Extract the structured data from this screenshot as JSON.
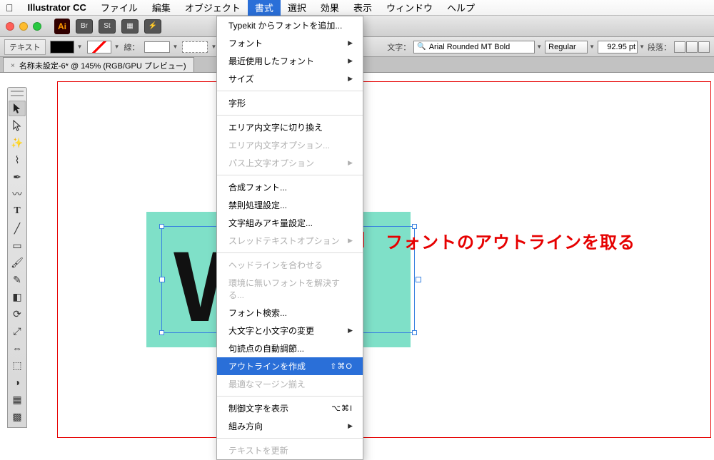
{
  "menubar": {
    "app": "Illustrator CC",
    "items": [
      "ファイル",
      "編集",
      "オブジェクト",
      "書式",
      "選択",
      "効果",
      "表示",
      "ウィンドウ",
      "ヘルプ"
    ],
    "active_index": 3
  },
  "titlebar": {
    "ai": "Ai",
    "btn1": "Br",
    "btn2": "St"
  },
  "optionsbar": {
    "tool_label": "テキスト",
    "stroke_label": "線：",
    "char_label": "文字：",
    "font_value": "Arial Rounded MT Bold",
    "style_value": "Regular",
    "size_value": "92.95 pt",
    "para_label": "段落："
  },
  "doc_tab": {
    "title": "名称未設定-6* @ 145% (RGB/GPU プレビュー)"
  },
  "dropdown": {
    "groups": [
      [
        {
          "label": "Typekit からフォントを追加...",
          "disabled": false
        },
        {
          "label": "フォント",
          "disabled": false,
          "submenu": true
        },
        {
          "label": "最近使用したフォント",
          "disabled": false,
          "submenu": true
        },
        {
          "label": "サイズ",
          "disabled": false,
          "submenu": true
        }
      ],
      [
        {
          "label": "字形",
          "disabled": false
        }
      ],
      [
        {
          "label": "エリア内文字に切り換え",
          "disabled": false
        },
        {
          "label": "エリア内文字オプション...",
          "disabled": true
        },
        {
          "label": "パス上文字オプション",
          "disabled": true,
          "submenu": true
        }
      ],
      [
        {
          "label": "合成フォント...",
          "disabled": false
        },
        {
          "label": "禁則処理設定...",
          "disabled": false
        },
        {
          "label": "文字組みアキ量設定...",
          "disabled": false
        },
        {
          "label": "スレッドテキストオプション",
          "disabled": true,
          "submenu": true
        }
      ],
      [
        {
          "label": "ヘッドラインを合わせる",
          "disabled": true
        },
        {
          "label": "環境に無いフォントを解決する...",
          "disabled": true
        },
        {
          "label": "フォント検索...",
          "disabled": false
        },
        {
          "label": "大文字と小文字の変更",
          "disabled": false,
          "submenu": true
        },
        {
          "label": "句読点の自動調節...",
          "disabled": false
        },
        {
          "label": "アウトラインを作成",
          "disabled": false,
          "highlighted": true,
          "shortcut": "⇧⌘O"
        },
        {
          "label": "最適なマージン揃え",
          "disabled": true
        }
      ],
      [
        {
          "label": "制御文字を表示",
          "disabled": false,
          "shortcut": "⌥⌘I"
        },
        {
          "label": "組み方向",
          "disabled": false,
          "submenu": true
        }
      ],
      [
        {
          "label": "テキストを更新",
          "disabled": true
        }
      ]
    ]
  },
  "annotation": "フォントのアウトラインを取る",
  "canvas_letter": "W"
}
